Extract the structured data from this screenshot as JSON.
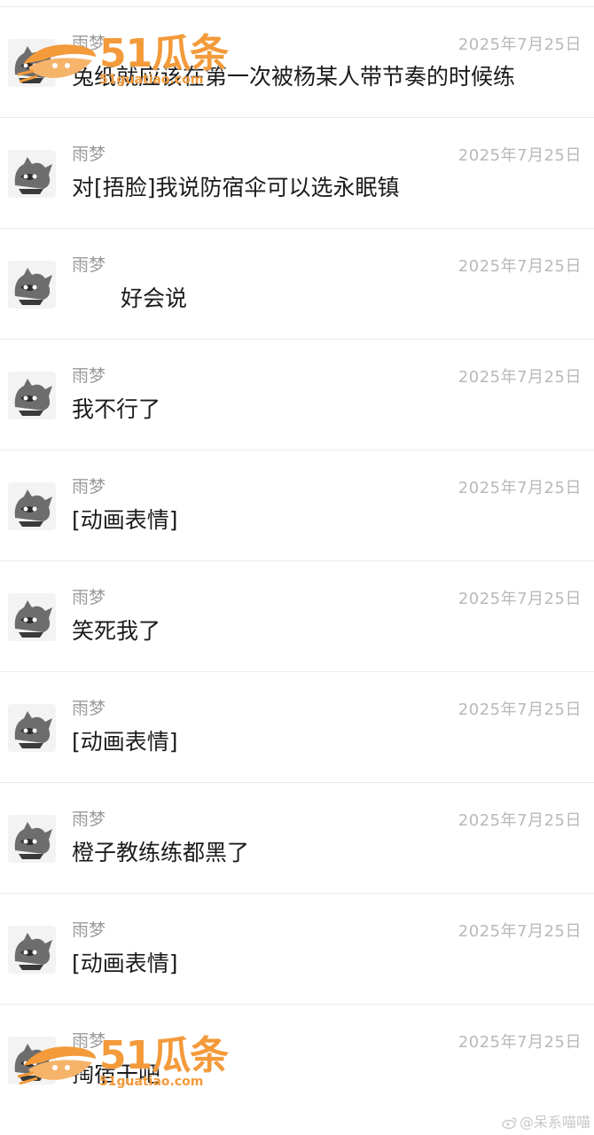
{
  "messages": [
    {
      "name": "雨梦",
      "date": "2025年7月25日",
      "text": "兔纸就应该在第一次被杨某人带节奏的时候练"
    },
    {
      "name": "雨梦",
      "date": "2025年7月25日",
      "text": "对[捂脸]我说防宿伞可以选永眠镇"
    },
    {
      "name": "雨梦",
      "date": "2025年7月25日",
      "text": "好会说"
    },
    {
      "name": "雨梦",
      "date": "2025年7月25日",
      "text": "我不行了"
    },
    {
      "name": "雨梦",
      "date": "2025年7月25日",
      "text": "[动画表情]"
    },
    {
      "name": "雨梦",
      "date": "2025年7月25日",
      "text": "笑死我了"
    },
    {
      "name": "雨梦",
      "date": "2025年7月25日",
      "text": "[动画表情]"
    },
    {
      "name": "雨梦",
      "date": "2025年7月25日",
      "text": "橙子教练练都黑了"
    },
    {
      "name": "雨梦",
      "date": "2025年7月25日",
      "text": "[动画表情]"
    },
    {
      "name": "雨梦",
      "date": "2025年7月25日",
      "text": "掏宿干吧"
    }
  ],
  "watermark": {
    "brand": "51瓜条",
    "url": "51guatiao.com"
  },
  "credit": "@呆系喵喵",
  "colors": {
    "watermark_orange": "#f39a3a",
    "name_gray": "#9a9a9a",
    "date_gray": "#b9b9b9",
    "divider": "#ececec"
  }
}
